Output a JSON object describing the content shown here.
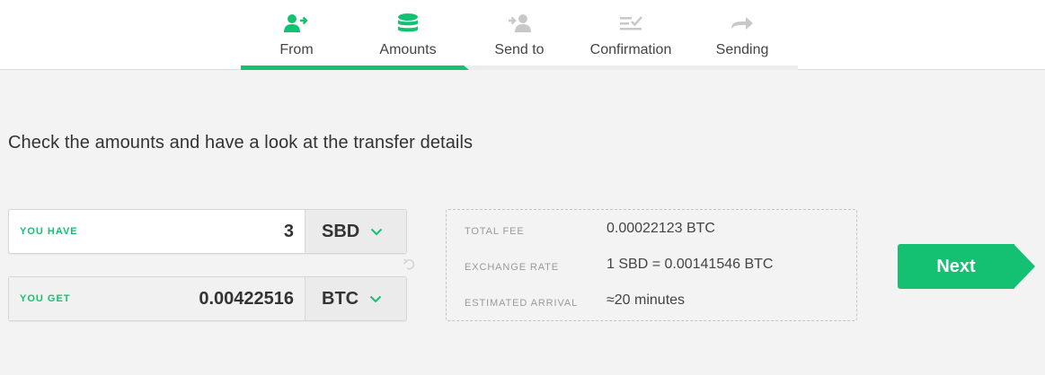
{
  "steps": [
    {
      "label": "From",
      "icon": "user-transfer-icon",
      "state": "done"
    },
    {
      "label": "Amounts",
      "icon": "coin-stack-icon",
      "state": "active"
    },
    {
      "label": "Send to",
      "icon": "user-receive-icon",
      "state": "pending"
    },
    {
      "label": "Confirmation",
      "icon": "list-check-icon",
      "state": "pending"
    },
    {
      "label": "Sending",
      "icon": "arrow-right-icon",
      "state": "pending"
    }
  ],
  "progress": {
    "percent": 40
  },
  "headline": "Check the amounts and have a look at the transfer details",
  "you_have": {
    "label": "YOU HAVE",
    "amount": "3",
    "currency": "SBD"
  },
  "you_get": {
    "label": "YOU GET",
    "amount": "0.00422516",
    "currency": "BTC"
  },
  "details": {
    "fee_label": "TOTAL FEE",
    "fee_value": "0.00022123 BTC",
    "rate_label": "EXCHANGE RATE",
    "rate_value": "1 SBD = 0.00141546 BTC",
    "arrival_label": "ESTIMATED ARRIVAL",
    "arrival_value": "≈20 minutes"
  },
  "next_label": "Next",
  "colors": {
    "accent": "#14c172",
    "inactive_icon": "#c8c8c8"
  }
}
